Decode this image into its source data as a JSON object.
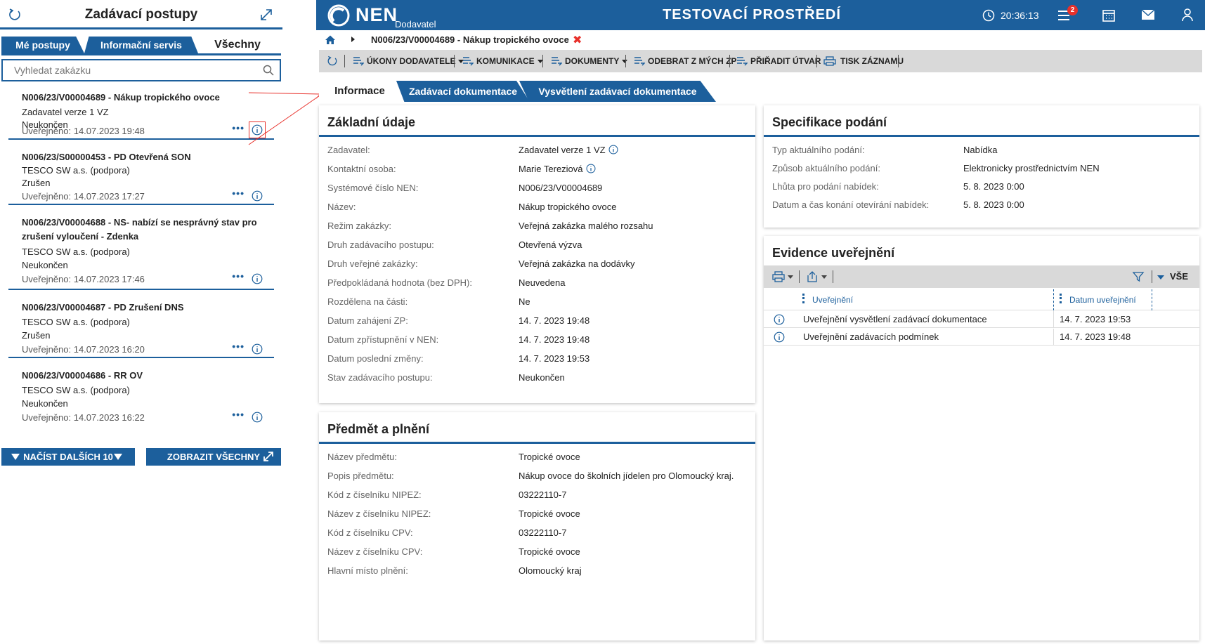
{
  "left_panel": {
    "title": "Zadávací postupy",
    "tabs": [
      "Mé postupy",
      "Informační servis",
      "Všechny"
    ],
    "search_placeholder": "Vyhledat zakázku",
    "items": [
      {
        "code": "N006/23/V00004689 - Nákup tropického ovoce",
        "line1": "Zadavatel verze 1 VZ",
        "line2": "Neukončen",
        "published": "Uveřejněno: 14.07.2023 19:48"
      },
      {
        "code": "N006/23/S00000453 - PD Otevřená SON",
        "line1": "TESCO SW a.s. (podpora)",
        "line2": "Zrušen",
        "published": "Uveřejněno: 14.07.2023 17:27"
      },
      {
        "code": "N006/23/V00004688 - NS- nabízí se nesprávný stav pro zrušení vyloučení - Zdenka",
        "line1": "TESCO SW a.s. (podpora)",
        "line2": "Neukončen",
        "published": "Uveřejněno: 14.07.2023 17:46"
      },
      {
        "code": "N006/23/V00004687 - PD Zrušení DNS",
        "line1": "TESCO SW a.s. (podpora)",
        "line2": "Zrušen",
        "published": "Uveřejněno: 14.07.2023 16:20"
      },
      {
        "code": "N006/23/V00004686 - RR OV",
        "line1": "TESCO SW a.s. (podpora)",
        "line2": "Neukončen",
        "published": "Uveřejněno: 14.07.2023 16:22"
      }
    ],
    "dots": "•••",
    "load_more": "NAČÍST DALŠÍCH 10",
    "show_all": "ZOBRAZIT VŠECHNY"
  },
  "header": {
    "logo": "NEN",
    "sublogo": "Dodavatel",
    "environment": "TESTOVACÍ PROSTŘEDÍ",
    "time": "20:36:13",
    "notifications": "2"
  },
  "breadcrumb": {
    "current": "N006/23/V00004689 - Nákup tropického ovoce",
    "close": "✖"
  },
  "toolbar": {
    "ukony": "ÚKONY DODAVATELE",
    "komunikace": "KOMUNIKACE",
    "dokumenty": "DOKUMENTY",
    "odebrat": "ODEBRAT Z MÝCH ZP",
    "priradit": "PŘIŘADIT ÚTVAR",
    "tisk": "TISK ZÁZNAMU"
  },
  "tabs": [
    "Informace",
    "Zadávací dokumentace",
    "Vysvětlení zadávací dokumentace"
  ],
  "zakladni": {
    "title": "Základní údaje",
    "rows": [
      {
        "k": "Zadavatel:",
        "v": "Zadavatel verze 1 VZ"
      },
      {
        "k": "Kontaktní osoba:",
        "v": "Marie  Tereziová"
      },
      {
        "k": "Systémové číslo NEN:",
        "v": "N006/23/V00004689"
      },
      {
        "k": "Název:",
        "v": "Nákup tropického ovoce"
      },
      {
        "k": "Režim zakázky:",
        "v": "Veřejná zakázka malého rozsahu"
      },
      {
        "k": "Druh zadávacího postupu:",
        "v": "Otevřená výzva"
      },
      {
        "k": "Druh veřejné zakázky:",
        "v": "Veřejná zakázka na dodávky"
      },
      {
        "k": "Předpokládaná hodnota (bez DPH):",
        "v": "Neuvedena"
      },
      {
        "k": "Rozdělena na části:",
        "v": "Ne"
      },
      {
        "k": "Datum zahájení ZP:",
        "v": "14. 7. 2023 19:48"
      },
      {
        "k": "Datum zpřístupnění v NEN:",
        "v": "14. 7. 2023 19:48"
      },
      {
        "k": "Datum poslední změny:",
        "v": "14. 7. 2023 19:53"
      },
      {
        "k": "Stav zadávacího postupu:",
        "v": "Neukončen"
      }
    ]
  },
  "predmet": {
    "title": "Předmět a plnění",
    "rows": [
      {
        "k": "Název předmětu:",
        "v": "Tropické ovoce"
      },
      {
        "k": "Popis předmětu:",
        "v": "Nákup ovoce do školních jídelen pro Olomoucký kraj."
      },
      {
        "k": "Kód z číselníku NIPEZ:",
        "v": "03222110-7"
      },
      {
        "k": "Název z číselníku NIPEZ:",
        "v": "Tropické ovoce"
      },
      {
        "k": "Kód z číselníku CPV:",
        "v": "03222110-7"
      },
      {
        "k": "Název z číselníku CPV:",
        "v": "Tropické ovoce"
      },
      {
        "k": "Hlavní místo plnění:",
        "v": "Olomoucký kraj"
      }
    ]
  },
  "specifikace": {
    "title": "Specifikace podání",
    "rows": [
      {
        "k": "Typ aktuálního podání:",
        "v": "Nabídka"
      },
      {
        "k": "Způsob aktuálního podání:",
        "v": "Elektronicky prostřednictvím NEN"
      },
      {
        "k": "Lhůta pro podání nabídek:",
        "v": "5. 8. 2023 0:00"
      },
      {
        "k": "Datum a čas konání otevírání nabídek:",
        "v": "5. 8. 2023 0:00"
      }
    ]
  },
  "evidence": {
    "title": "Evidence uveřejnění",
    "filter_label": "VŠE",
    "col_name": "Uveřejnění",
    "col_date": "Datum uveřejnění",
    "rows": [
      {
        "name": "Uveřejnění vysvětlení zadávací dokumentace",
        "date": "14. 7. 2023 19:53"
      },
      {
        "name": "Uveřejnění zadávacích podmínek",
        "date": "14. 7. 2023 19:48"
      }
    ]
  },
  "colors": {
    "primary": "#1c5f9c",
    "accent": "#e8302a",
    "toolbar": "#d9d9d9"
  }
}
